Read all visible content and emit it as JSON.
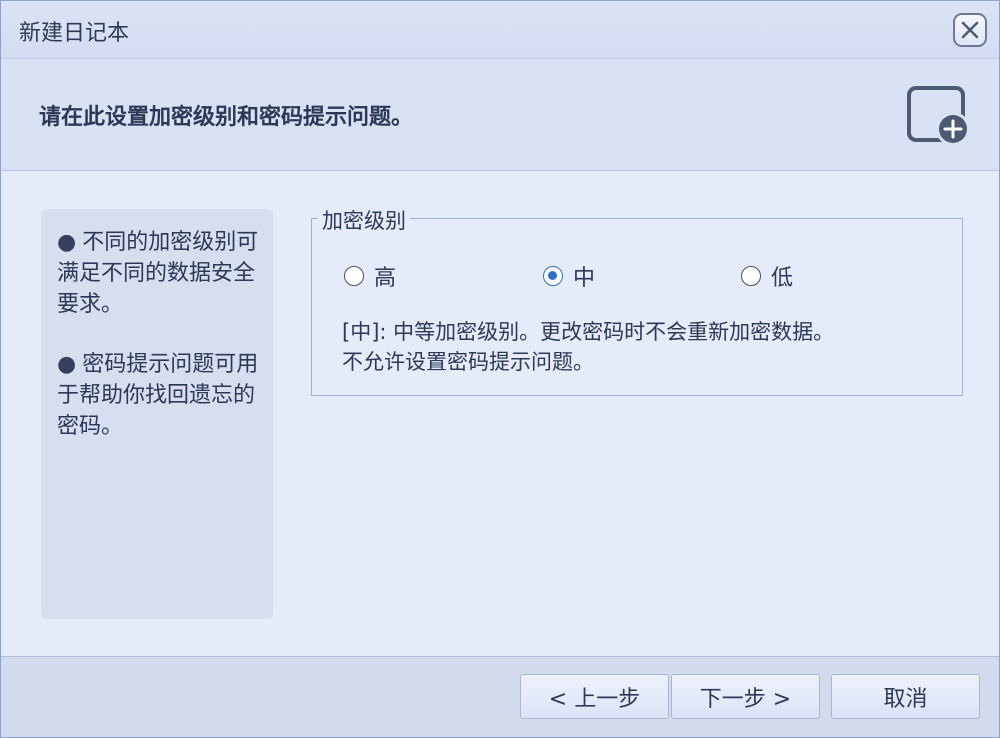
{
  "window": {
    "title": "新建日记本"
  },
  "header": {
    "heading": "请在此设置加密级别和密码提示问题。"
  },
  "tips": [
    {
      "bullet": "●",
      "text": "不同的加密级别可满足不同的数据安全要求。"
    },
    {
      "bullet": "●",
      "text": "密码提示问题可用于帮助你找回遗忘的密码。"
    }
  ],
  "encryption": {
    "legend": "加密级别",
    "options": [
      {
        "label": "高",
        "checked": false
      },
      {
        "label": "中",
        "checked": true
      },
      {
        "label": "低",
        "checked": false
      }
    ],
    "description_line1": "[中]: 中等加密级别。更改密码时不会重新加密数据。",
    "description_line2": "不允许设置密码提示问题。"
  },
  "footer": {
    "back_label": "< 上一步",
    "next_label": "下一步 >",
    "cancel_label": "取消"
  },
  "colors": {
    "accent": "#2f6fc9",
    "background": "#e6ebf9"
  },
  "icons": {
    "close": "close-icon",
    "header": "new-notebook-icon"
  }
}
